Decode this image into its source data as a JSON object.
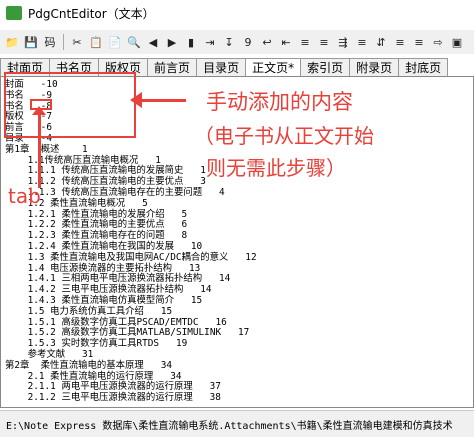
{
  "window": {
    "title": "PdgCntEditor（文本）"
  },
  "toolbar": {
    "items": [
      "📁",
      "💾",
      "码",
      "✂",
      "📋",
      "📄",
      "🔍",
      "◀",
      "▶",
      "▮",
      "⇥",
      "↧",
      "9",
      "↩",
      "⇤",
      "≡",
      "≡",
      "⇶",
      "≡",
      "⇵",
      "≡",
      "≡",
      "⇨",
      "▣"
    ]
  },
  "tabs": [
    "封面页",
    "书名页",
    "版权页",
    "前言页",
    "目录页",
    "正文页*",
    "索引页",
    "附录页",
    "封底页"
  ],
  "active_tab": "正文页*",
  "content": {
    "lines": [
      "封面   -10",
      "书名   -9",
      "书名   -8",
      "版权   -7",
      "前言   -6",
      "目录   -4",
      "第1章  概述    1",
      "    1.1传统高压直流输电概况   1",
      "    1.1.1 传统高压直流输电的发展简史   1",
      "    1.1.2 传统高压直流输电的主要优点   3",
      "    1.1.3 传统高压直流输电存在的主要问题   4",
      "    1.2 柔性直流输电概况   5",
      "    1.2.1 柔性直流输电的发展介绍   5",
      "    1.2.2 柔性直流输电的主要优点   6",
      "    1.2.3 柔性直流输电存在的问题   8",
      "    1.2.4 柔性直流输电在我国的发展   10",
      "    1.3 柔性直流输电及我国电网AC/DC耦合的意义   12",
      "    1.4 电压源换流器的主要拓扑结构   13",
      "    1.4.1 三相两电平电压源换流器拓扑结构   14",
      "    1.4.2 三电平电压源换流器拓扑结构   14",
      "    1.4.3 柔性直流输电仿真模型简介   15",
      "    1.5 电力系统仿真工具介绍   15",
      "    1.5.1 高级数字仿真工具PSCAD/EMTDC   16",
      "    1.5.2 高级数字仿真工具MATLAB/SIMULINK   17",
      "    1.5.3 实时数字仿真工具RTDS   19",
      "    参考文献   31",
      "第2章  柔性直流输电的基本原理   34",
      "    2.1 柔性直流输电的运行原理   34",
      "    2.1.1 两电平电压源换流器的运行原理   37",
      "    2.1.2 三电平电压源换流器的运行原理   38"
    ]
  },
  "status": {
    "path": "E:\\Note Express 数据库\\柔性直流输电系统.Attachments\\书籍\\柔性直流输电建模和仿真技术"
  },
  "annotations": {
    "manual_add_title": "手动添加的内容",
    "manual_add_line1": "（电子书从正文开始",
    "manual_add_line2": "则无需此步骤）",
    "tab_label": "tab"
  },
  "colors": {
    "annotation": "#e8403a"
  }
}
